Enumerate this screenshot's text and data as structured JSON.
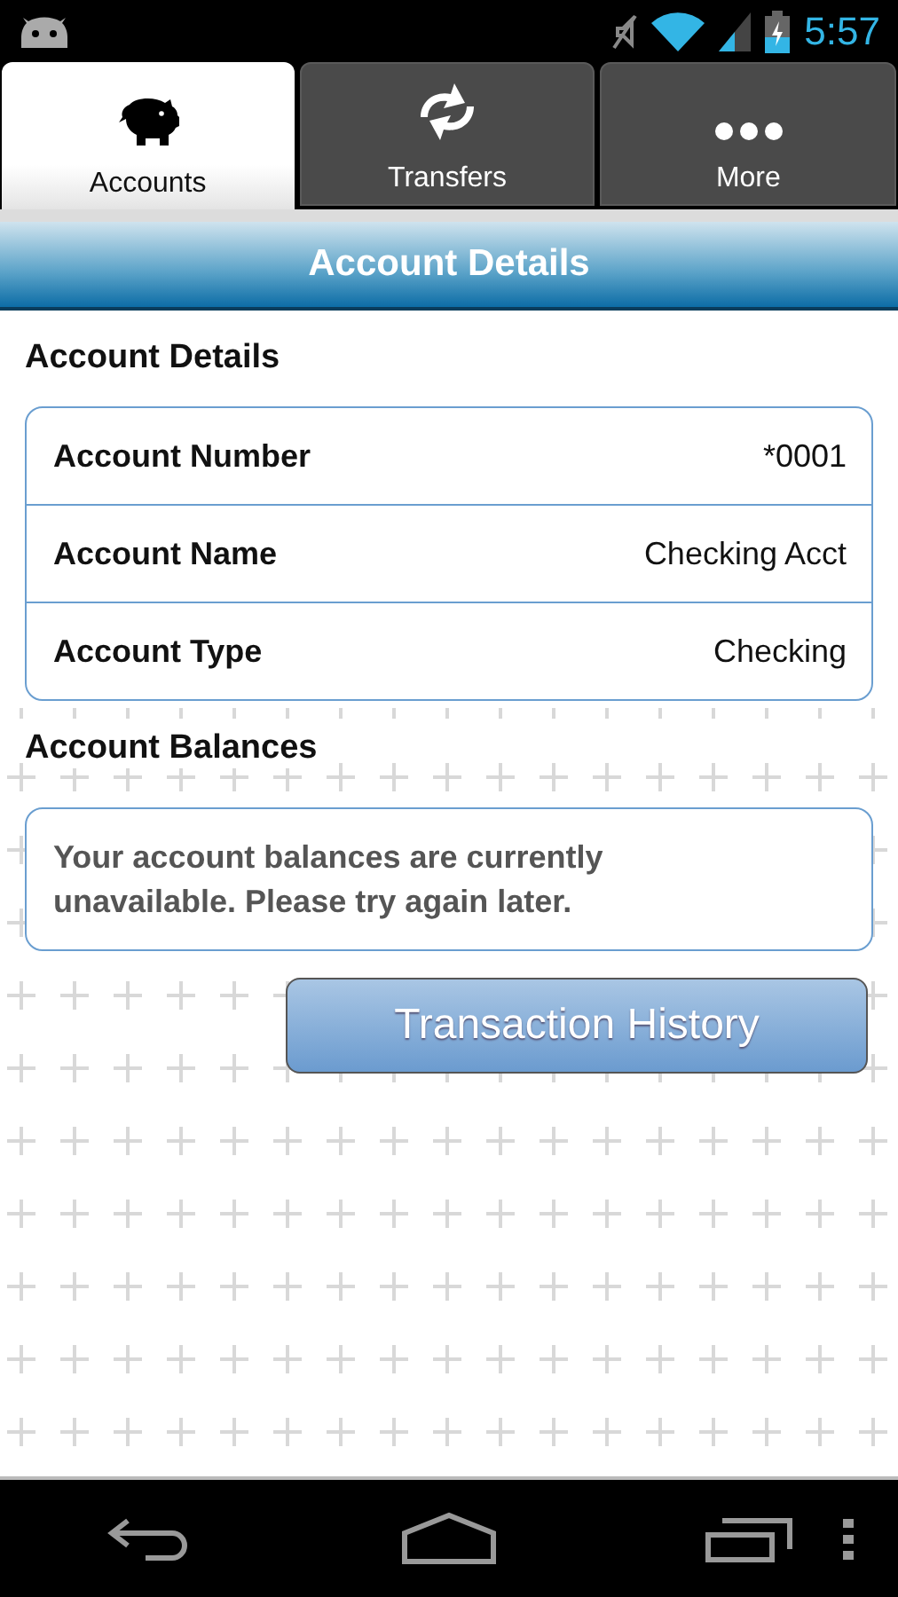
{
  "status_bar": {
    "time": "5:57"
  },
  "tabs": [
    {
      "label": "Accounts",
      "kind": "piggy",
      "selected": true
    },
    {
      "label": "Transfers",
      "kind": "arrows",
      "selected": false
    },
    {
      "label": "More",
      "kind": "dots",
      "selected": false
    }
  ],
  "header": {
    "title": "Account Details"
  },
  "details": {
    "heading": "Account Details",
    "rows": [
      {
        "label": "Account Number",
        "value": "*0001"
      },
      {
        "label": "Account Name",
        "value": "Checking Acct"
      },
      {
        "label": "Account Type",
        "value": "Checking"
      }
    ]
  },
  "balances": {
    "heading": "Account Balances",
    "message": "Your account balances are currently unavailable. Please try again later."
  },
  "button": {
    "label": "Transaction History"
  }
}
